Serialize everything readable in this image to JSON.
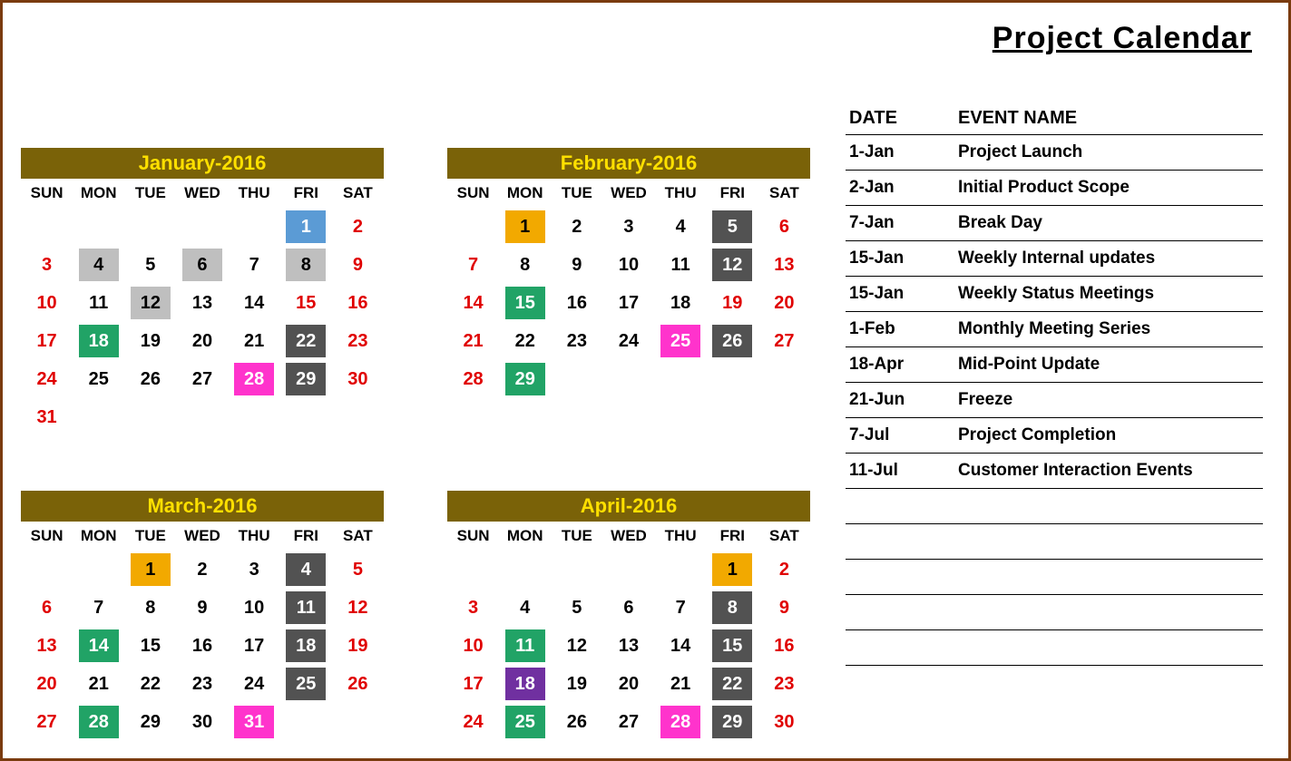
{
  "title": "Project Calendar",
  "colors": {
    "header_bg": "#7a6208",
    "header_fg": "#ffe000",
    "red": "#e00000",
    "orange": "#f2a900",
    "blue": "#5b9bd5",
    "light_grey": "#bfbfbf",
    "dark_grey": "#525252",
    "green": "#21a366",
    "pink": "#ff33cc",
    "purple": "#7030a0"
  },
  "day_headers": [
    "SUN",
    "MON",
    "TUE",
    "WED",
    "THU",
    "FRI",
    "SAT"
  ],
  "events": {
    "headers": {
      "date": "DATE",
      "name": "EVENT NAME"
    },
    "rows": [
      {
        "date": "1-Jan",
        "name": "Project Launch"
      },
      {
        "date": "2-Jan",
        "name": "Initial Product Scope"
      },
      {
        "date": "7-Jan",
        "name": "Break Day"
      },
      {
        "date": "15-Jan",
        "name": "Weekly Internal updates"
      },
      {
        "date": "15-Jan",
        "name": "Weekly Status Meetings"
      },
      {
        "date": "1-Feb",
        "name": "Monthly Meeting Series"
      },
      {
        "date": "18-Apr",
        "name": "Mid-Point Update"
      },
      {
        "date": "21-Jun",
        "name": "Freeze"
      },
      {
        "date": "7-Jul",
        "name": "Project Completion"
      },
      {
        "date": "11-Jul",
        "name": "Customer Interaction Events"
      }
    ],
    "blank_rows": 5
  },
  "months": [
    {
      "title": "January-2016",
      "weeks": [
        [
          {
            "d": ""
          },
          {
            "d": ""
          },
          {
            "d": ""
          },
          {
            "d": ""
          },
          {
            "d": ""
          },
          {
            "d": "1",
            "bg": "blue",
            "fg": "white"
          },
          {
            "d": "2",
            "fg": "red"
          }
        ],
        [
          {
            "d": "3",
            "fg": "red"
          },
          {
            "d": "4",
            "bg": "lg"
          },
          {
            "d": "5"
          },
          {
            "d": "6",
            "bg": "lg"
          },
          {
            "d": "7"
          },
          {
            "d": "8",
            "bg": "lg"
          },
          {
            "d": "9",
            "fg": "red"
          }
        ],
        [
          {
            "d": "10",
            "fg": "red"
          },
          {
            "d": "11"
          },
          {
            "d": "12",
            "bg": "lg"
          },
          {
            "d": "13"
          },
          {
            "d": "14"
          },
          {
            "d": "15",
            "fg": "red"
          },
          {
            "d": "16",
            "fg": "red"
          }
        ],
        [
          {
            "d": "17",
            "fg": "red"
          },
          {
            "d": "18",
            "bg": "green",
            "fg": "white"
          },
          {
            "d": "19"
          },
          {
            "d": "20"
          },
          {
            "d": "21"
          },
          {
            "d": "22",
            "bg": "dg",
            "fg": "white"
          },
          {
            "d": "23",
            "fg": "red"
          }
        ],
        [
          {
            "d": "24",
            "fg": "red"
          },
          {
            "d": "25"
          },
          {
            "d": "26"
          },
          {
            "d": "27"
          },
          {
            "d": "28",
            "bg": "pink",
            "fg": "white"
          },
          {
            "d": "29",
            "bg": "dg",
            "fg": "white"
          },
          {
            "d": "30",
            "fg": "red"
          }
        ],
        [
          {
            "d": "31",
            "fg": "red"
          },
          {
            "d": ""
          },
          {
            "d": ""
          },
          {
            "d": ""
          },
          {
            "d": ""
          },
          {
            "d": ""
          },
          {
            "d": ""
          }
        ]
      ]
    },
    {
      "title": "February-2016",
      "weeks": [
        [
          {
            "d": ""
          },
          {
            "d": "1",
            "bg": "orange"
          },
          {
            "d": "2"
          },
          {
            "d": "3"
          },
          {
            "d": "4"
          },
          {
            "d": "5",
            "bg": "dg",
            "fg": "white"
          },
          {
            "d": "6",
            "fg": "red"
          }
        ],
        [
          {
            "d": "7",
            "fg": "red"
          },
          {
            "d": "8"
          },
          {
            "d": "9"
          },
          {
            "d": "10"
          },
          {
            "d": "11"
          },
          {
            "d": "12",
            "bg": "dg",
            "fg": "white"
          },
          {
            "d": "13",
            "fg": "red"
          }
        ],
        [
          {
            "d": "14",
            "fg": "red"
          },
          {
            "d": "15",
            "bg": "green",
            "fg": "white"
          },
          {
            "d": "16"
          },
          {
            "d": "17"
          },
          {
            "d": "18"
          },
          {
            "d": "19",
            "fg": "red"
          },
          {
            "d": "20",
            "fg": "red"
          }
        ],
        [
          {
            "d": "21",
            "fg": "red"
          },
          {
            "d": "22"
          },
          {
            "d": "23"
          },
          {
            "d": "24"
          },
          {
            "d": "25",
            "bg": "pink",
            "fg": "white"
          },
          {
            "d": "26",
            "bg": "dg",
            "fg": "white"
          },
          {
            "d": "27",
            "fg": "red"
          }
        ],
        [
          {
            "d": "28",
            "fg": "red"
          },
          {
            "d": "29",
            "bg": "green",
            "fg": "white"
          },
          {
            "d": ""
          },
          {
            "d": ""
          },
          {
            "d": ""
          },
          {
            "d": ""
          },
          {
            "d": ""
          }
        ]
      ]
    },
    {
      "title": "March-2016",
      "weeks": [
        [
          {
            "d": ""
          },
          {
            "d": ""
          },
          {
            "d": "1",
            "bg": "orange"
          },
          {
            "d": "2"
          },
          {
            "d": "3"
          },
          {
            "d": "4",
            "bg": "dg",
            "fg": "white"
          },
          {
            "d": "5",
            "fg": "red"
          }
        ],
        [
          {
            "d": "6",
            "fg": "red"
          },
          {
            "d": "7"
          },
          {
            "d": "8"
          },
          {
            "d": "9"
          },
          {
            "d": "10"
          },
          {
            "d": "11",
            "bg": "dg",
            "fg": "white"
          },
          {
            "d": "12",
            "fg": "red"
          }
        ],
        [
          {
            "d": "13",
            "fg": "red"
          },
          {
            "d": "14",
            "bg": "green",
            "fg": "white"
          },
          {
            "d": "15"
          },
          {
            "d": "16"
          },
          {
            "d": "17"
          },
          {
            "d": "18",
            "bg": "dg",
            "fg": "white"
          },
          {
            "d": "19",
            "fg": "red"
          }
        ],
        [
          {
            "d": "20",
            "fg": "red"
          },
          {
            "d": "21"
          },
          {
            "d": "22"
          },
          {
            "d": "23"
          },
          {
            "d": "24"
          },
          {
            "d": "25",
            "bg": "dg",
            "fg": "white"
          },
          {
            "d": "26",
            "fg": "red"
          }
        ],
        [
          {
            "d": "27",
            "fg": "red"
          },
          {
            "d": "28",
            "bg": "green",
            "fg": "white"
          },
          {
            "d": "29"
          },
          {
            "d": "30"
          },
          {
            "d": "31",
            "bg": "pink",
            "fg": "white"
          },
          {
            "d": ""
          },
          {
            "d": ""
          }
        ]
      ]
    },
    {
      "title": "April-2016",
      "weeks": [
        [
          {
            "d": ""
          },
          {
            "d": ""
          },
          {
            "d": ""
          },
          {
            "d": ""
          },
          {
            "d": ""
          },
          {
            "d": "1",
            "bg": "orange"
          },
          {
            "d": "2",
            "fg": "red"
          }
        ],
        [
          {
            "d": "3",
            "fg": "red"
          },
          {
            "d": "4"
          },
          {
            "d": "5"
          },
          {
            "d": "6"
          },
          {
            "d": "7"
          },
          {
            "d": "8",
            "bg": "dg",
            "fg": "white"
          },
          {
            "d": "9",
            "fg": "red"
          }
        ],
        [
          {
            "d": "10",
            "fg": "red"
          },
          {
            "d": "11",
            "bg": "green",
            "fg": "white"
          },
          {
            "d": "12"
          },
          {
            "d": "13"
          },
          {
            "d": "14"
          },
          {
            "d": "15",
            "bg": "dg",
            "fg": "white"
          },
          {
            "d": "16",
            "fg": "red"
          }
        ],
        [
          {
            "d": "17",
            "fg": "red"
          },
          {
            "d": "18",
            "bg": "purple",
            "fg": "white"
          },
          {
            "d": "19"
          },
          {
            "d": "20"
          },
          {
            "d": "21"
          },
          {
            "d": "22",
            "bg": "dg",
            "fg": "white"
          },
          {
            "d": "23",
            "fg": "red"
          }
        ],
        [
          {
            "d": "24",
            "fg": "red"
          },
          {
            "d": "25",
            "bg": "green",
            "fg": "white"
          },
          {
            "d": "26"
          },
          {
            "d": "27"
          },
          {
            "d": "28",
            "bg": "pink",
            "fg": "white"
          },
          {
            "d": "29",
            "bg": "dg",
            "fg": "white"
          },
          {
            "d": "30",
            "fg": "red"
          }
        ]
      ]
    }
  ]
}
